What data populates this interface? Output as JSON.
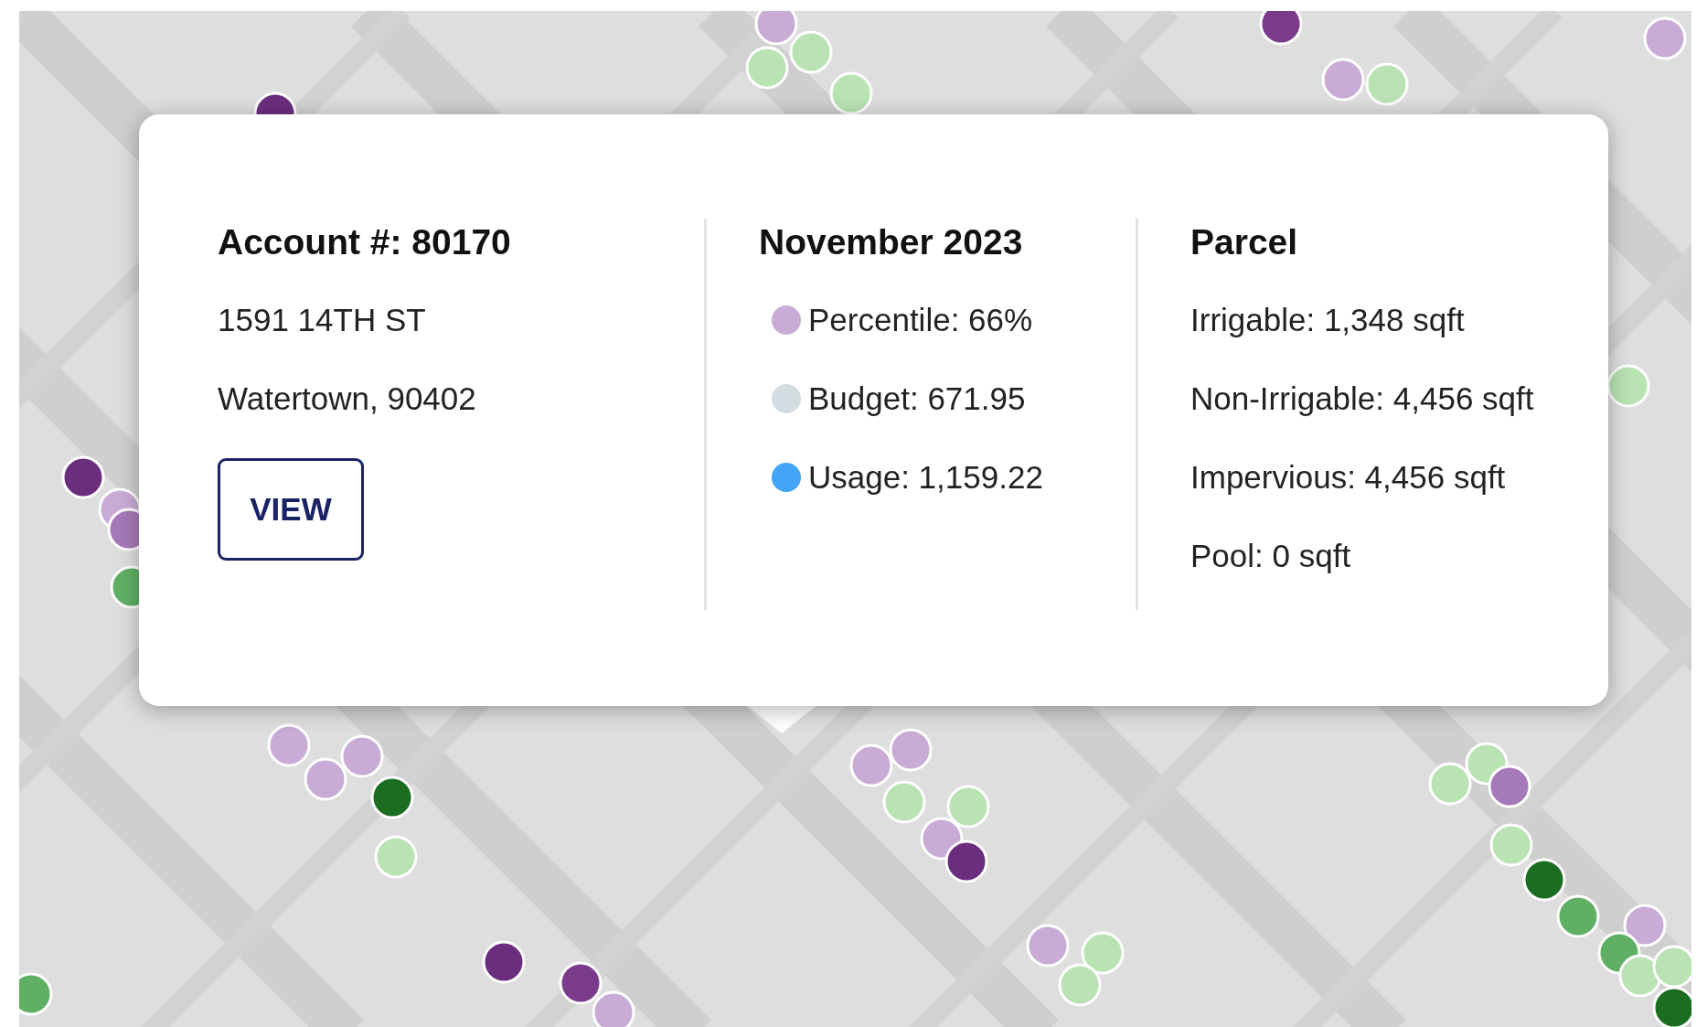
{
  "account": {
    "title": "Account #: 80170",
    "address_lines": [
      "1591 14TH ST",
      "Watertown, 90402"
    ],
    "button": "VIEW"
  },
  "month": {
    "title": "November 2023",
    "items": [
      {
        "label": "Percentile: 66%",
        "color": "#c9acd6"
      },
      {
        "label": "Budget: 671.95",
        "color": "#d3dce0"
      },
      {
        "label": "Usage: 1,159.22",
        "color": "#42a5f5"
      }
    ]
  },
  "parcel": {
    "title": "Parcel",
    "items": [
      "Irrigable: 1,348 sqft",
      "Non-Irrigable: 4,456 sqft",
      "Impervious: 4,456 sqft",
      "Pool: 0 sqft"
    ]
  }
}
